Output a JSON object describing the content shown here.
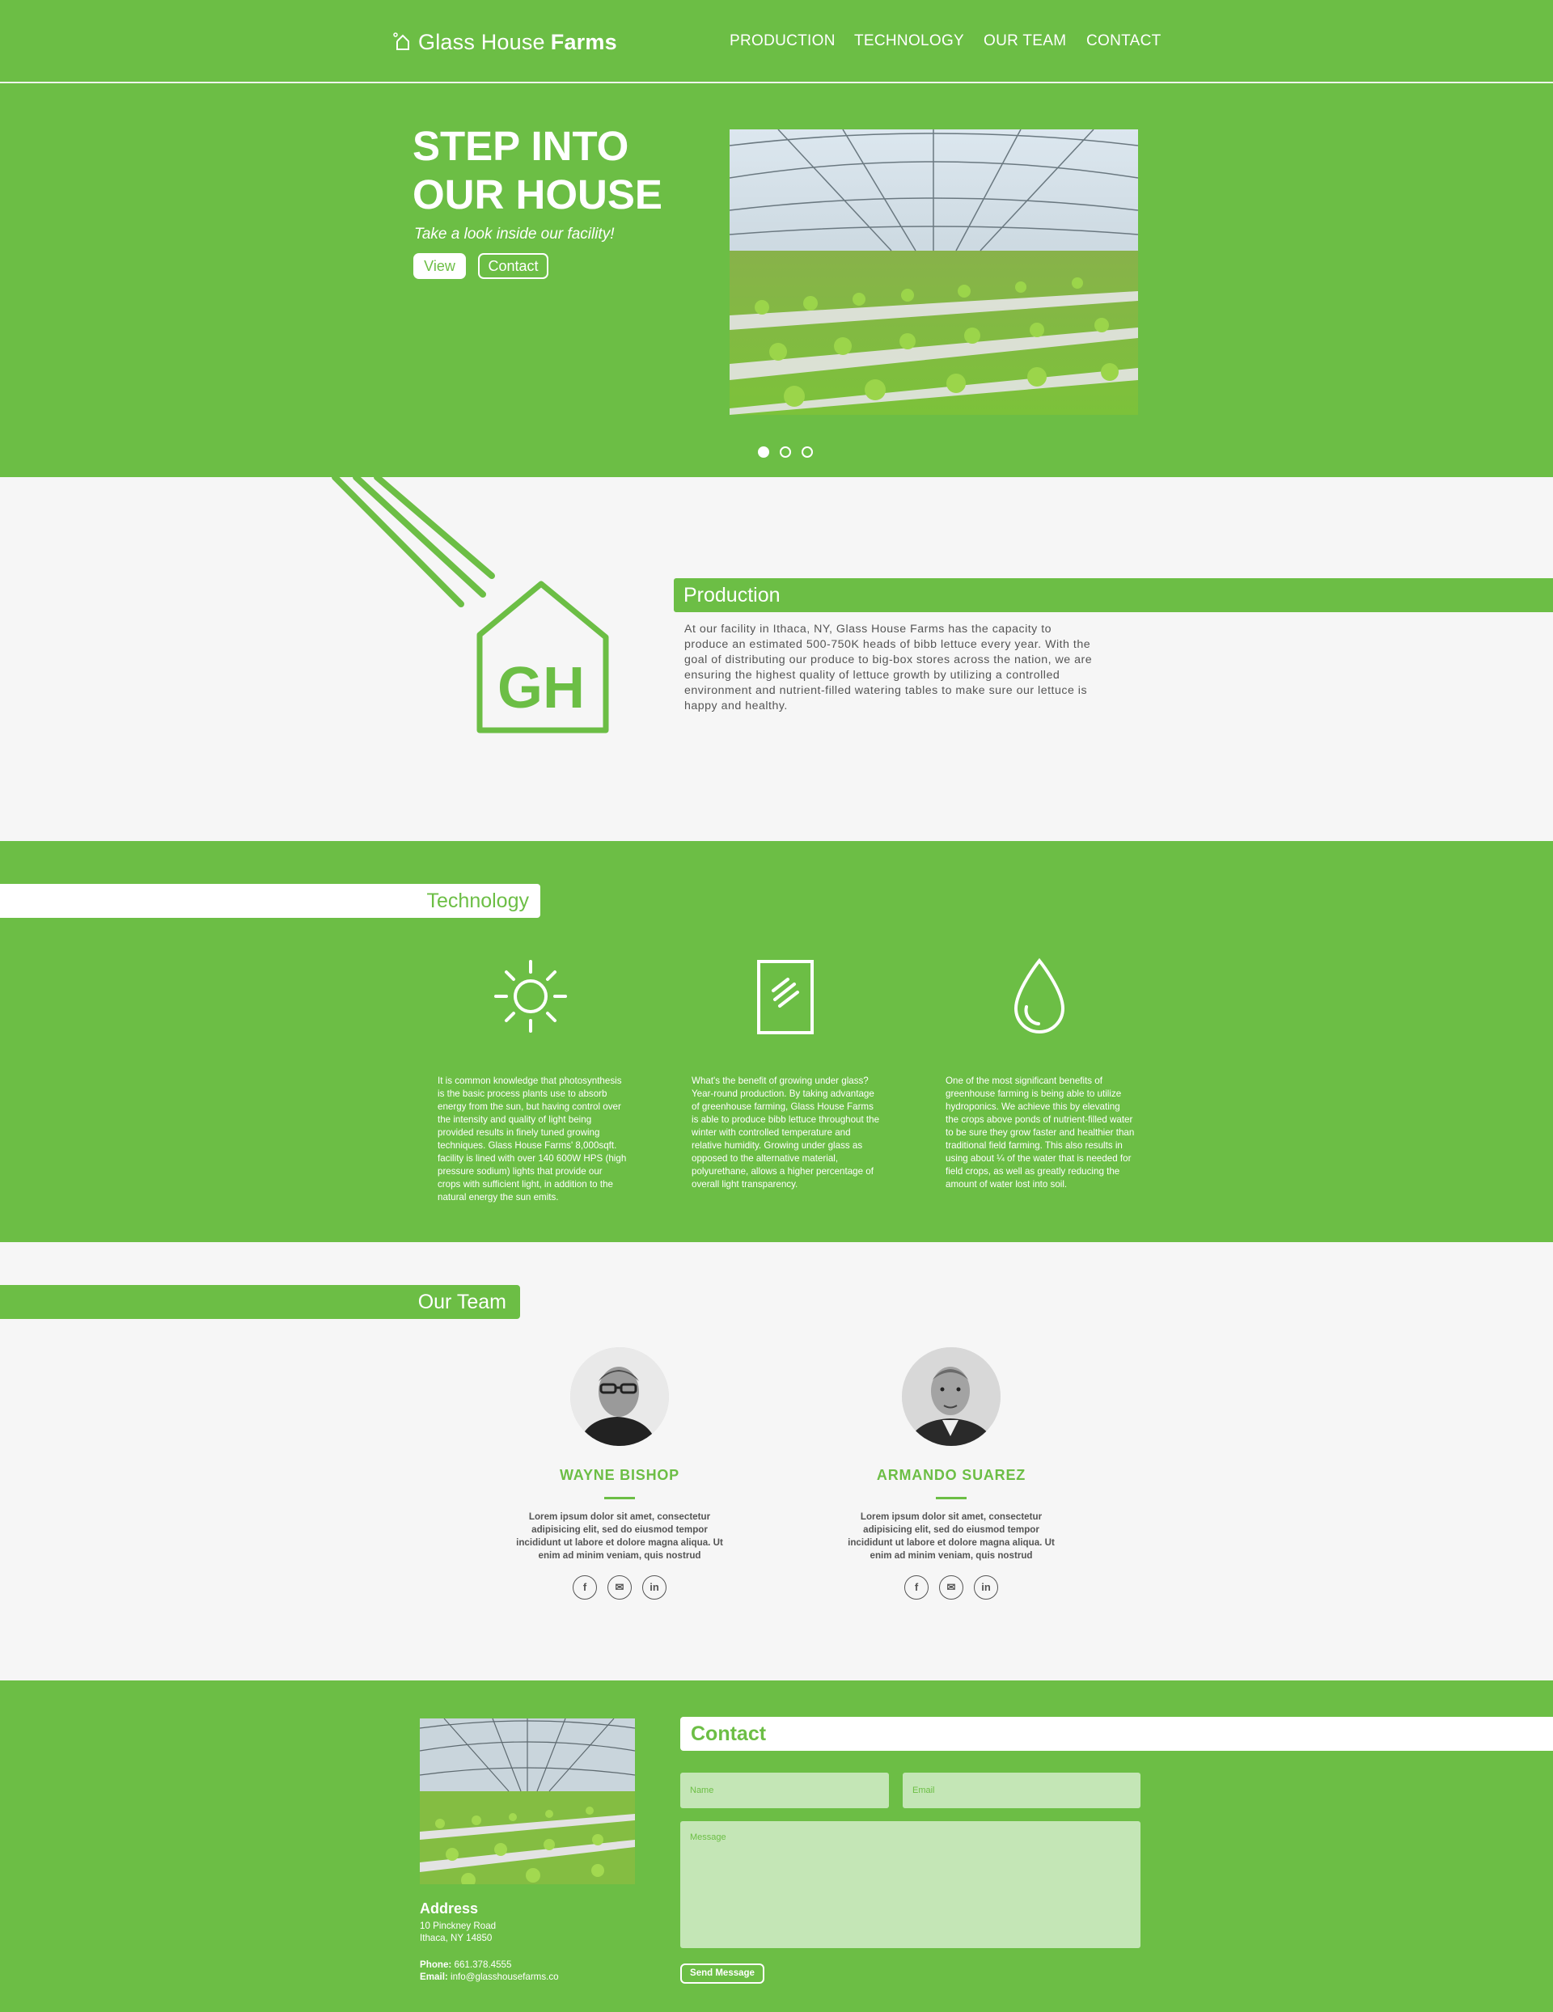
{
  "header": {
    "logo_light": "Glass House",
    "logo_bold": "Farms",
    "nav": [
      "PRODUCTION",
      "TECHNOLOGY",
      "OUR TEAM",
      "CONTACT"
    ]
  },
  "hero": {
    "title_line1": "STEP INTO",
    "title_line2": "OUR HOUSE",
    "subtitle": "Take a look inside our facility!",
    "view_label": "View",
    "contact_label": "Contact",
    "slides_total": 3,
    "active_slide": 1
  },
  "production": {
    "logo_text": "GH",
    "title": "Production",
    "text": "At our facility in Ithaca, NY, Glass House Farms has the capacity to produce an estimated 500-750K heads of bibb lettuce every year. With the goal of distributing our produce to big-box stores across the nation, we are ensuring the highest quality of lettuce growth by utilizing a controlled environment and nutrient-filled watering tables to make sure our lettuce is happy and healthy."
  },
  "technology": {
    "title": "Technology",
    "items": [
      {
        "icon": "sun-icon",
        "text": "It is common knowledge that photosynthesis is the basic process plants use to absorb energy from the sun, but having control over the intensity and quality of light being provided results in finely tuned growing techniques. Glass House Farms' 8,000sqft. facility is lined with over 140 600W HPS (high pressure sodium) lights that provide our crops with sufficient light, in addition to the natural energy the sun emits."
      },
      {
        "icon": "glass-pane-icon",
        "text": "What's the benefit of growing under glass? Year-round production. By taking advantage of greenhouse farming, Glass House Farms is able to produce bibb lettuce throughout the winter with controlled temperature and relative humidity. Growing under glass as opposed to the alternative material, polyurethane, allows a higher percentage of overall light transparency."
      },
      {
        "icon": "water-drop-icon",
        "text": "One of the most significant benefits of greenhouse farming is being able to utilize hydroponics. We achieve this by elevating the crops above ponds of nutrient-filled water to be sure they grow faster and healthier than traditional field farming. This also results in using about ¼ of the water that is needed for field crops, as well as greatly reducing the amount of water lost into soil."
      }
    ]
  },
  "team": {
    "title": "Our Team",
    "members": [
      {
        "name": "WAYNE BISHOP",
        "bio": "Lorem ipsum dolor sit amet, consectetur adipisicing elit, sed do eiusmod tempor incididunt ut labore et dolore magna aliqua. Ut enim ad minim veniam, quis nostrud",
        "socials": [
          "f",
          "✉",
          "in"
        ]
      },
      {
        "name": "ARMANDO SUAREZ",
        "bio": "Lorem ipsum dolor sit amet, consectetur adipisicing elit, sed do eiusmod tempor incididunt ut labore et dolore magna aliqua. Ut enim ad minim veniam, quis nostrud",
        "socials": [
          "f",
          "✉",
          "in"
        ]
      }
    ]
  },
  "contact": {
    "title": "Contact",
    "address_title": "Address",
    "address_line1": "10 Pinckney Road",
    "address_line2": "Ithaca, NY 14850",
    "phone_label": "Phone:",
    "phone": "661.378.4555",
    "email_label": "Email:",
    "email": "info@glasshousefarms.co",
    "name_placeholder": "Name",
    "email_placeholder": "Email",
    "message_placeholder": "Message",
    "send_label": "Send Message"
  },
  "colors": {
    "brand_green": "#6cbe45",
    "light_green": "#c4e6b6",
    "background": "#f6f6f6"
  }
}
